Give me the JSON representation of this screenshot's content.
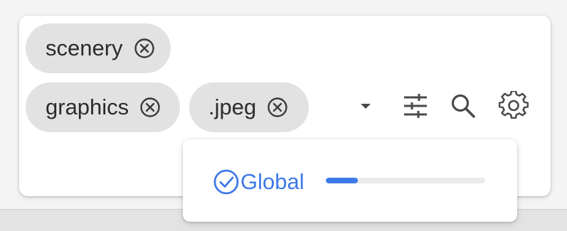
{
  "tags": [
    {
      "label": "scenery",
      "remove_icon": "close-circle-icon"
    },
    {
      "label": "graphics",
      "remove_icon": "close-circle-icon"
    },
    {
      "label": ".jpeg",
      "remove_icon": "close-circle-icon"
    }
  ],
  "toolbar": {
    "dropdown_icon": "caret-down-icon",
    "filter_icon": "tune-sliders-icon",
    "search_icon": "search-icon",
    "settings_icon": "gear-icon"
  },
  "scope_menu": {
    "option_label": "Global",
    "option_icon": "check-circle-icon",
    "progress": 0.2
  },
  "colors": {
    "accent": "#3f79e8",
    "chip_bg": "#e2e2e2",
    "icon": "#4a4a4a"
  }
}
